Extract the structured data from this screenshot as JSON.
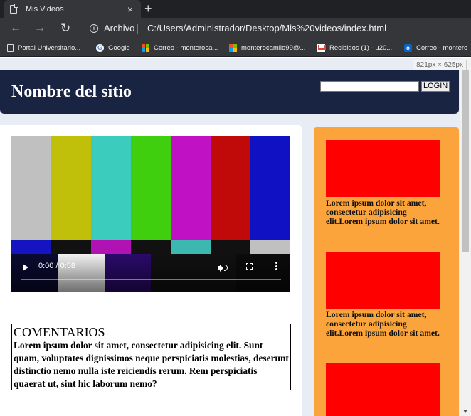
{
  "browser": {
    "tab_title": "Mis Videos",
    "tab_close": "×",
    "new_tab": "+",
    "address_label": "Archivo",
    "address_url": "C:/Users/Administrador/Desktop/Mis%20videos/index.html",
    "bookmarks": [
      {
        "label": "Portal Universitario...",
        "icon": "page-icon"
      },
      {
        "label": "Google",
        "icon": "google-icon"
      },
      {
        "label": "Correo - monteroca...",
        "icon": "microsoft-icon"
      },
      {
        "label": "monterocamilo99@...",
        "icon": "microsoft-icon"
      },
      {
        "label": "Recibidos (1) - u20...",
        "icon": "gmail-icon"
      },
      {
        "label": "Correo - montero",
        "icon": "outlook-icon"
      }
    ],
    "viewport_size": "821px × 625px"
  },
  "site": {
    "title": "Nombre del sitio",
    "search_value": "",
    "login_label": "LOGIN"
  },
  "video": {
    "time": "0:00 / 0:58",
    "progress": 0
  },
  "comments": {
    "title": "COMENTARIOS",
    "text": "Lorem ipsum dolor sit amet, consectetur adipisicing elit. Sunt quam, voluptates dignissimos neque perspiciatis molestias, deserunt distinctio nemo nulla iste reiciendis rerum. Rem perspiciatis quaerat ut, sint hic laborum nemo?"
  },
  "sidebar": {
    "cards": [
      {
        "text": "Lorem ipsum dolor sit amet, consectetur adipisicing elit.Lorem ipsum dolor sit amet."
      },
      {
        "text": "Lorem ipsum dolor sit amet, consectetur adipisicing elit.Lorem ipsum dolor sit amet."
      },
      {
        "text": ""
      }
    ]
  },
  "colors": {
    "header_bg": "#192342",
    "sidebar_bg": "#fba43c",
    "card_image": "#ff0000",
    "page_bg": "#e8ecf5"
  }
}
